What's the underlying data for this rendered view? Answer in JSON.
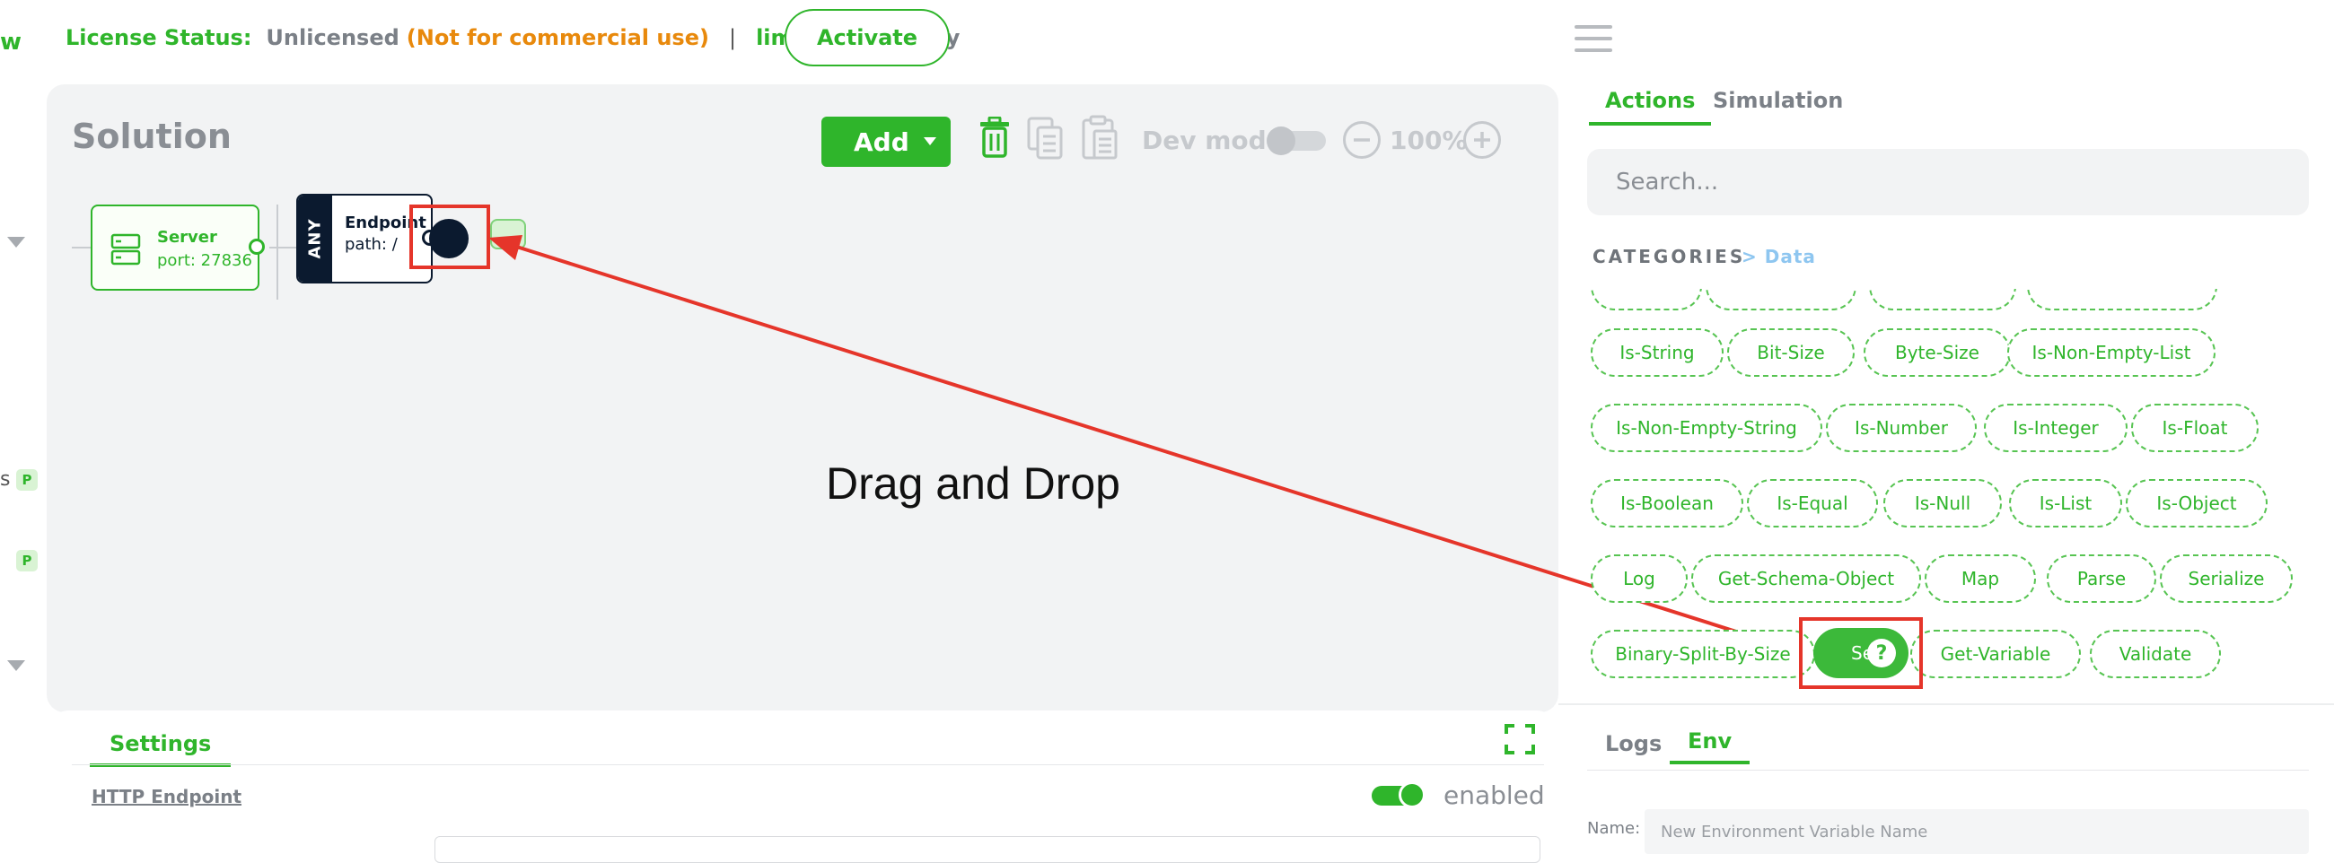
{
  "license": {
    "brand_fragment": "w",
    "label": "License Status:",
    "status": "Unlicensed",
    "warning": "(Not for commercial use)",
    "separator": "|",
    "limitations": "limitations",
    "apply": "apply",
    "activate_label": "Activate"
  },
  "canvas": {
    "title": "Solution",
    "add_label": "Add",
    "dev_mode_label": "Dev mode",
    "zoom": "100%"
  },
  "nodes": {
    "server": {
      "title": "Server",
      "port": "port: 27836"
    },
    "endpoint": {
      "method": "ANY",
      "title": "Endpoint",
      "path": "path: /"
    }
  },
  "annotation": {
    "drag_label": "Drag and Drop"
  },
  "right_panel": {
    "tabs": [
      {
        "label": "Actions"
      },
      {
        "label": "Simulation"
      }
    ],
    "search_placeholder": "Search...",
    "categories_label": "CATEGORIES",
    "breadcrumb": "> Data",
    "actions": [
      "Is-String",
      "Bit-Size",
      "Byte-Size",
      "Is-Non-Empty-List",
      "Is-Non-Empty-String",
      "Is-Number",
      "Is-Integer",
      "Is-Float",
      "Is-Boolean",
      "Is-Equal",
      "Is-Null",
      "Is-List",
      "Is-Object",
      "Log",
      "Get-Schema-Object",
      "Map",
      "Parse",
      "Serialize",
      "Binary-Split-By-Size",
      "Get-Variable",
      "Validate"
    ],
    "dragged_item": {
      "label": "Se",
      "help_glyph": "?"
    }
  },
  "settings": {
    "tab_label": "Settings",
    "node_link": "HTTP Endpoint",
    "enabled_label": "enabled",
    "enabled": true
  },
  "env": {
    "tabs": [
      {
        "label": "Logs"
      },
      {
        "label": "Env"
      }
    ],
    "name_label": "Name:",
    "name_placeholder": "New Environment Variable Name"
  },
  "left_rail": {
    "badges": [
      "P",
      "P"
    ],
    "clipped_letter": "s"
  },
  "colors": {
    "accent": "#2fb52b",
    "warning": "#e8890c",
    "node_dark": "#0b1a2f",
    "annotation_red": "#e5352a"
  }
}
